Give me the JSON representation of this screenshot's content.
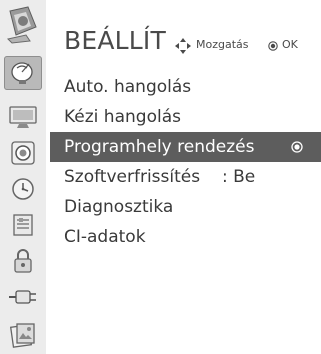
{
  "header": {
    "title": "BEÁLLÍT",
    "hint_move_label": "Mozgatás",
    "hint_ok_label": "OK"
  },
  "menu": {
    "items": [
      {
        "label": "Auto. hangolás",
        "value": ""
      },
      {
        "label": "Kézi hangolás",
        "value": ""
      },
      {
        "label": "Programhely rendezés",
        "value": "",
        "selected": true
      },
      {
        "label": "Szoftverfrissítés",
        "value": ": Be"
      },
      {
        "label": "Diagnosztika",
        "value": ""
      },
      {
        "label": "CI-adatok",
        "value": ""
      }
    ]
  },
  "sidebar": {
    "icons": [
      "tv-setup-icon",
      "antenna-icon",
      "picture-icon",
      "audio-icon",
      "time-icon",
      "option-icon",
      "lock-icon",
      "input-icon",
      "media-icon"
    ],
    "active_index": 0
  },
  "colors": {
    "selected_bg": "#5d5d5d",
    "sidebar_bg": "#ececec",
    "text": "#3a3a3a"
  }
}
